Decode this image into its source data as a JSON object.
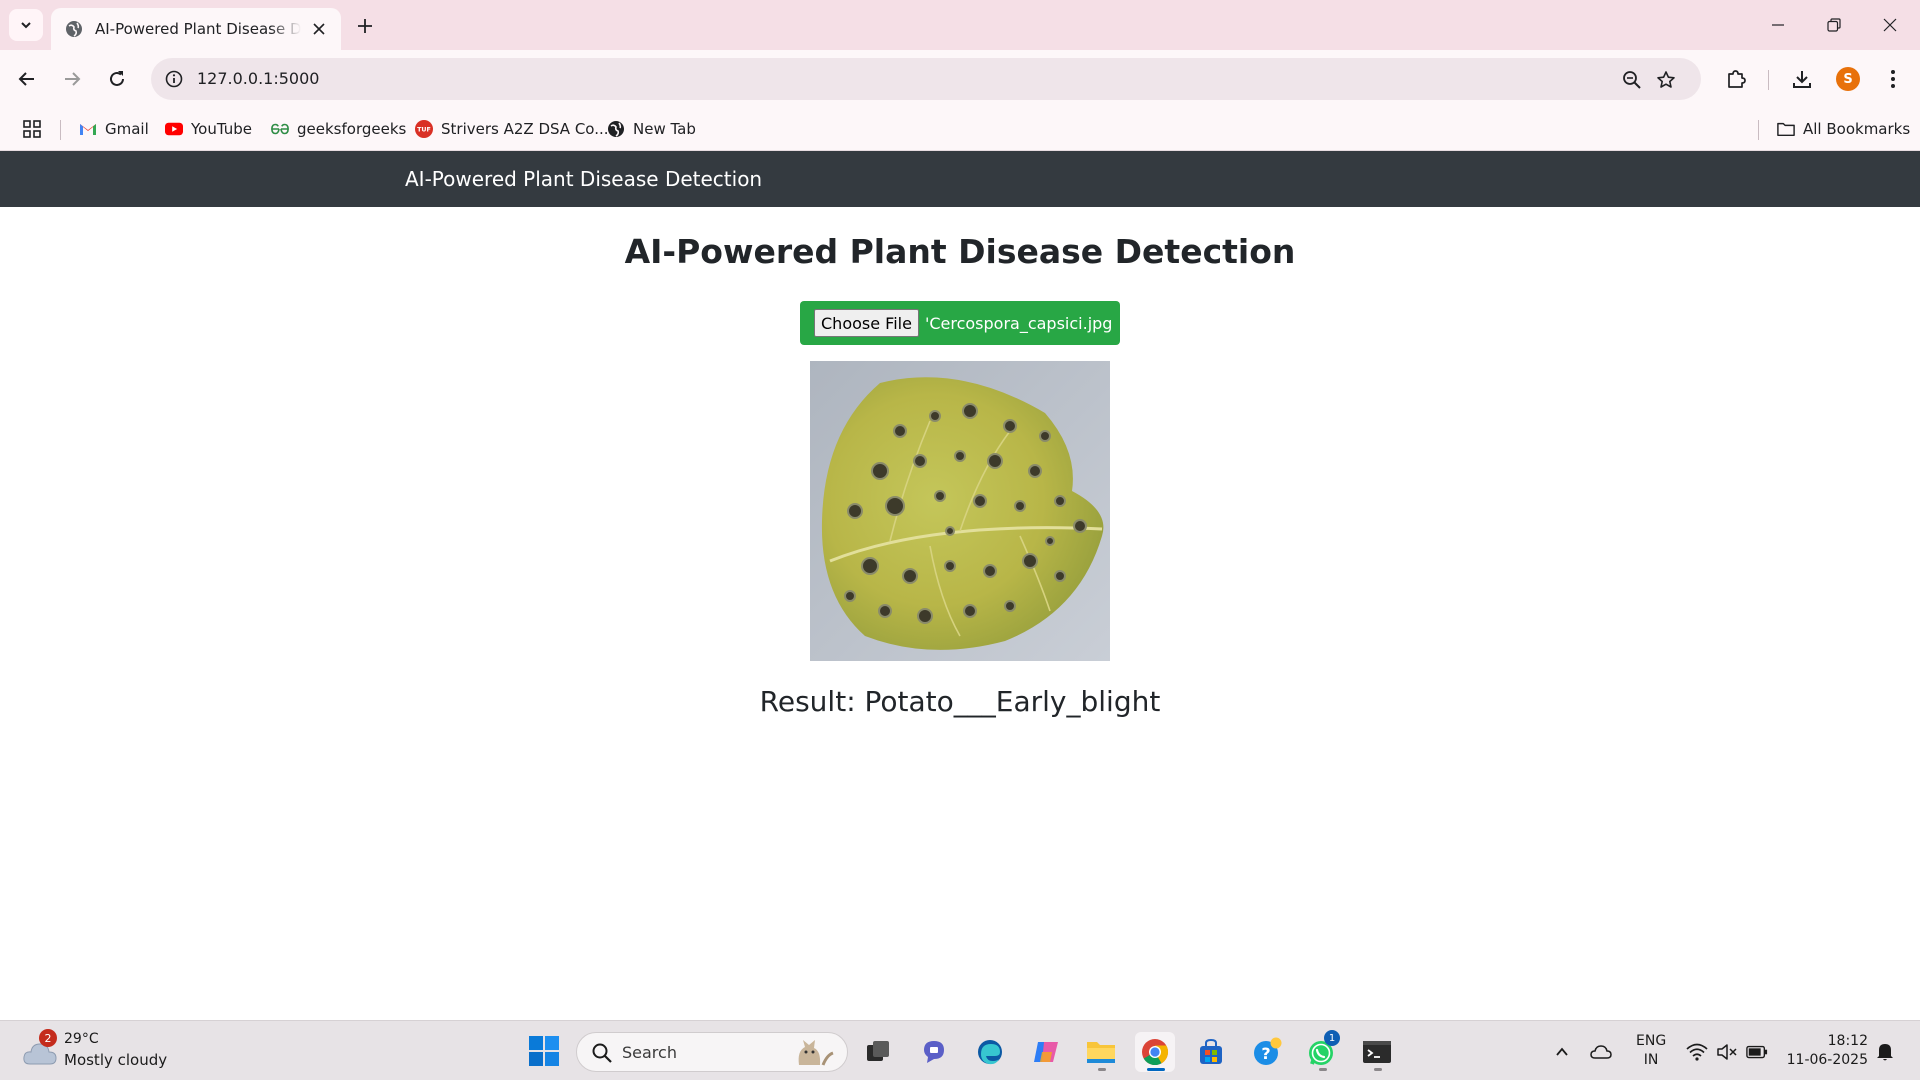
{
  "browser": {
    "tab_title": "AI-Powered Plant Disease Detection",
    "url": "127.0.0.1:5000",
    "profile_initial": "S",
    "bookmarks": [
      {
        "label": "Gmail",
        "icon": "gmail-icon"
      },
      {
        "label": "YouTube",
        "icon": "youtube-icon"
      },
      {
        "label": "geeksforgeeks",
        "icon": "geeksforgeeks-icon"
      },
      {
        "label": "Strivers A2Z DSA Co...",
        "icon": "tuf-icon"
      },
      {
        "label": "New Tab",
        "icon": "globe-icon"
      }
    ],
    "all_bookmarks": "All Bookmarks"
  },
  "page": {
    "brand": "AI-Powered Plant Disease Detection",
    "title": "AI-Powered Plant Disease Detection",
    "file_button": "Choose File",
    "file_name": "'Cercospora_capsici.jpg",
    "result": "Result: Potato___Early_blight"
  },
  "taskbar": {
    "weather_badge": "2",
    "temperature": "29°C",
    "weather_desc": "Mostly cloudy",
    "search_label": "Search",
    "whatsapp_badge": "1",
    "lang_line1": "ENG",
    "lang_line2": "IN",
    "time": "18:12",
    "date": "11-06-2025"
  },
  "colors": {
    "navbar": "#343a40",
    "file_input_bg": "#28a745",
    "tabstrip": "#f5dfe6",
    "profile": "#e8710a"
  }
}
